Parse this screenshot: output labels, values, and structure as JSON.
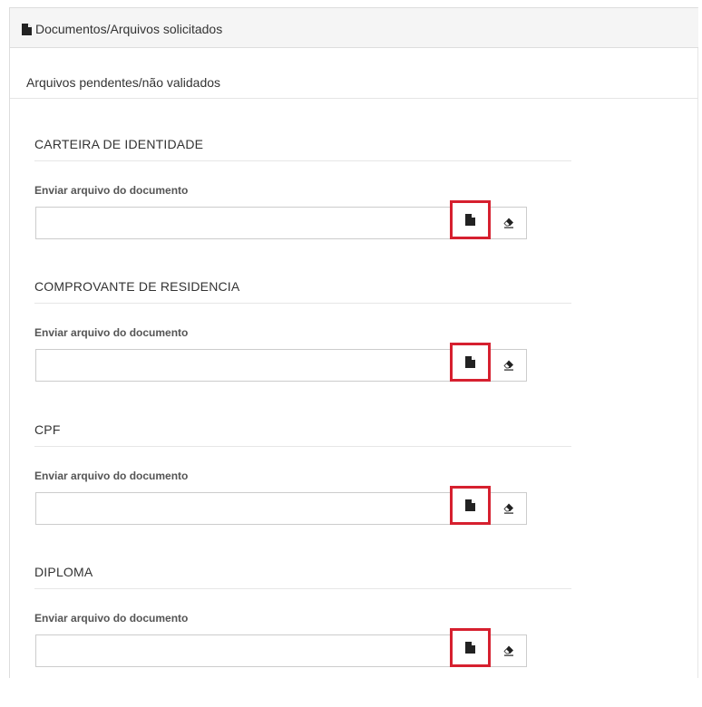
{
  "panel": {
    "title": "Documentos/Arquivos solicitados",
    "title_icon": "file-icon",
    "subtitle": "Arquivos pendentes/não validados"
  },
  "documents": [
    {
      "name": "CARTEIRA DE IDENTIDADE",
      "field_label": "Enviar arquivo do documento",
      "value": "",
      "select_icon": "file-icon",
      "clear_icon": "eraser-icon"
    },
    {
      "name": "COMPROVANTE DE RESIDENCIA",
      "field_label": "Enviar arquivo do documento",
      "value": "",
      "select_icon": "file-icon",
      "clear_icon": "eraser-icon"
    },
    {
      "name": "CPF",
      "field_label": "Enviar arquivo do documento",
      "value": "",
      "select_icon": "file-icon",
      "clear_icon": "eraser-icon"
    },
    {
      "name": "DIPLOMA",
      "field_label": "Enviar arquivo do documento",
      "value": "",
      "select_icon": "file-icon",
      "clear_icon": "eraser-icon"
    }
  ],
  "colors": {
    "highlight_border": "#d6202f",
    "heading_background": "#f5f5f5",
    "border": "#cccccc",
    "text": "#333333"
  }
}
